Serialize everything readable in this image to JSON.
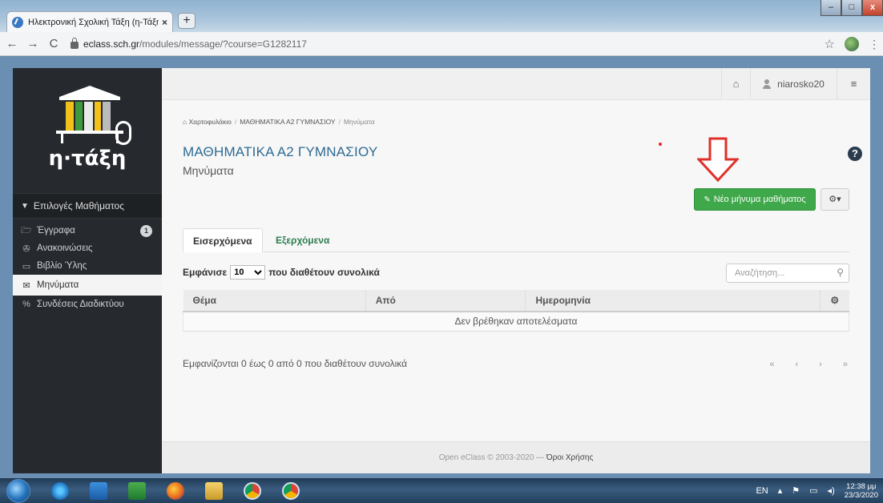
{
  "browser": {
    "tab_title": "Ηλεκτρονική Σχολική Τάξη (η-Τάξη)",
    "tab_close": "×",
    "newtab": "+",
    "url_host": "eclass.sch.gr",
    "url_path": "/modules/message/?course=G1282117",
    "nav_back": "←",
    "nav_forward": "→",
    "nav_reload": "C",
    "star": "☆",
    "menu": "⋮"
  },
  "sidebar": {
    "logo_text": "η·τάξη",
    "section_label": "Επιλογές Μαθήματος",
    "items": [
      {
        "label": "Έγγραφα",
        "icon": "folder-icon",
        "glyph": "🗁",
        "badge": "1"
      },
      {
        "label": "Ανακοινώσεις",
        "icon": "megaphone-icon",
        "glyph": "✇"
      },
      {
        "label": "Βιβλίο Ύλης",
        "icon": "calendar-icon",
        "glyph": "▭"
      },
      {
        "label": "Μηνύματα",
        "icon": "envelope-icon",
        "glyph": "✉"
      },
      {
        "label": "Συνδέσεις Διαδικτύου",
        "icon": "link-icon",
        "glyph": "%"
      }
    ]
  },
  "topnav": {
    "home_glyph": "⌂",
    "username": "niarosko20",
    "settings_glyph": "≡"
  },
  "breadcrumb": {
    "home": "Χαρτοφυλάκιο",
    "course": "ΜΑΘΗΜΑΤΙΚΑ Α2 ΓΥΜΝΑΣΙΟΥ",
    "current": "Μηνύματα"
  },
  "course_title": "ΜΑΘΗΜΑΤΙΚΑ Α2 ΓΥΜΝΑΣΙΟΥ",
  "page_subtitle": "Μηνύματα",
  "help_glyph": "?",
  "new_message_button": "Νέο μήνυμα μαθήματος",
  "gear_button": "⚙▾",
  "tabs": {
    "inbox": "Εισερχόμενα",
    "outbox": "Εξερχόμενα"
  },
  "filter": {
    "show_label": "Εμφάνισε",
    "page_size": "10",
    "total_label": "που διαθέτουν συνολικά",
    "search_placeholder": "Αναζήτηση..."
  },
  "table": {
    "columns": [
      "Θέμα",
      "Από",
      "Ημερομηνία",
      "⚙"
    ],
    "empty_message": "Δεν βρέθηκαν αποτελέσματα"
  },
  "info_text": "Εμφανίζονται 0 έως 0 από 0 που διαθέτουν συνολικά",
  "pager": [
    "«",
    "‹",
    "›",
    "»"
  ],
  "footer": {
    "copyright": "Open eClass © 2003-2020 — ",
    "terms": "Όροι Χρήσης"
  },
  "taskbar": {
    "lang": "EN",
    "time": "12:38 μμ",
    "date": "23/3/2020"
  },
  "colors": {
    "accent_green": "#3fa84a",
    "title_blue": "#2e6b93",
    "sidebar_dark": "#262a2e",
    "arrow_red": "#e0302a"
  }
}
